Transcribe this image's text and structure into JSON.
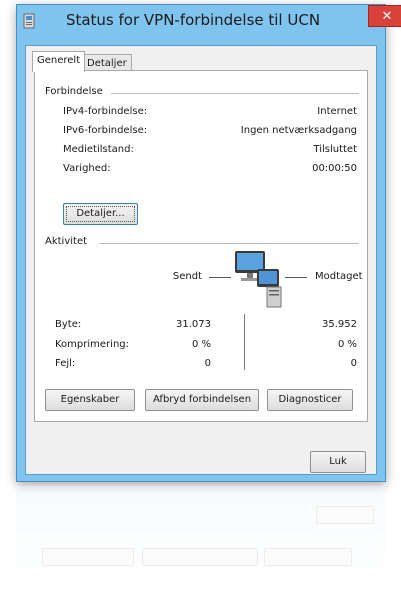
{
  "window": {
    "title": "Status for VPN-forbindelse til UCN",
    "close_glyph": "✕",
    "accent_color": "#7fc4ef",
    "close_color": "#d9423a"
  },
  "tabs": [
    {
      "label": "Generelt",
      "active": true
    },
    {
      "label": "Detaljer",
      "active": false
    }
  ],
  "connection": {
    "heading": "Forbindelse",
    "rows": [
      {
        "label": "IPv4-forbindelse:",
        "value": "Internet"
      },
      {
        "label": "IPv6-forbindelse:",
        "value": "Ingen netværksadgang"
      },
      {
        "label": "Medietilstand:",
        "value": "Tilsluttet"
      },
      {
        "label": "Varighed:",
        "value": "00:00:50"
      }
    ],
    "details_button": "Detaljer..."
  },
  "activity": {
    "heading": "Aktivitet",
    "sent_label": "Sendt",
    "received_label": "Modtaget",
    "icon": "network-computers-icon",
    "rows": [
      {
        "label": "Byte:",
        "sent": "31.073",
        "received": "35.952"
      },
      {
        "label": "Komprimering:",
        "sent": "0 %",
        "received": "0 %"
      },
      {
        "label": "Fejl:",
        "sent": "0",
        "received": "0"
      }
    ]
  },
  "actions": {
    "properties": "Egenskaber",
    "disconnect": "Afbryd forbindelsen",
    "diagnose": "Diagnosticer",
    "close": "Luk"
  }
}
